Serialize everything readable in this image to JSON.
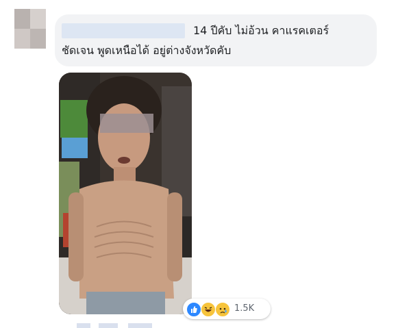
{
  "comment": {
    "text_line1": "14 ปีคับ ไม่อ้วน คาแรคเตอร์",
    "text_line2": "ชัดเจน พูดเหนือได้ อยู่ต่างจังหวัดคับ"
  },
  "reactions": {
    "icons": [
      "like-icon",
      "laugh-icon",
      "sad-icon"
    ],
    "count": "1.5K"
  },
  "colors": {
    "bubble_bg": "#f2f3f5",
    "like_blue": "#2d88ff",
    "emoji_yellow": "#f7c43c",
    "name_blur": "#dde6f3"
  }
}
